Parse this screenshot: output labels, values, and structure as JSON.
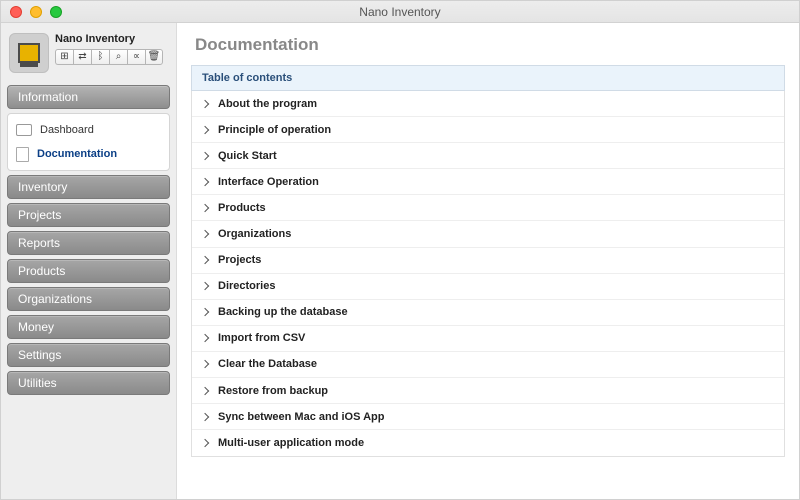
{
  "window": {
    "title": "Nano Inventory"
  },
  "sidebar": {
    "brand": {
      "name": "Nano Inventory"
    },
    "toolbar_icons": [
      "map-icon",
      "transfer-icon",
      "bluetooth-icon",
      "search-icon",
      "share-icon",
      "trash-icon"
    ],
    "sections": [
      {
        "label": "Information",
        "expanded": true,
        "items": [
          {
            "label": "Dashboard",
            "selected": false
          },
          {
            "label": "Documentation",
            "selected": true
          }
        ]
      },
      {
        "label": "Inventory"
      },
      {
        "label": "Projects"
      },
      {
        "label": "Reports"
      },
      {
        "label": "Products"
      },
      {
        "label": "Organizations"
      },
      {
        "label": "Money"
      },
      {
        "label": "Settings"
      },
      {
        "label": "Utilities"
      }
    ]
  },
  "content": {
    "title": "Documentation",
    "toc_header": "Table of contents",
    "toc": [
      "About the program",
      "Principle of operation",
      "Quick Start",
      "Interface Operation",
      "Products",
      "Organizations",
      "Projects",
      "Directories",
      "Backing up the database",
      "Import from CSV",
      "Clear the Database",
      "Restore from backup",
      "Sync between Mac and iOS App",
      "Multi-user application mode"
    ]
  }
}
